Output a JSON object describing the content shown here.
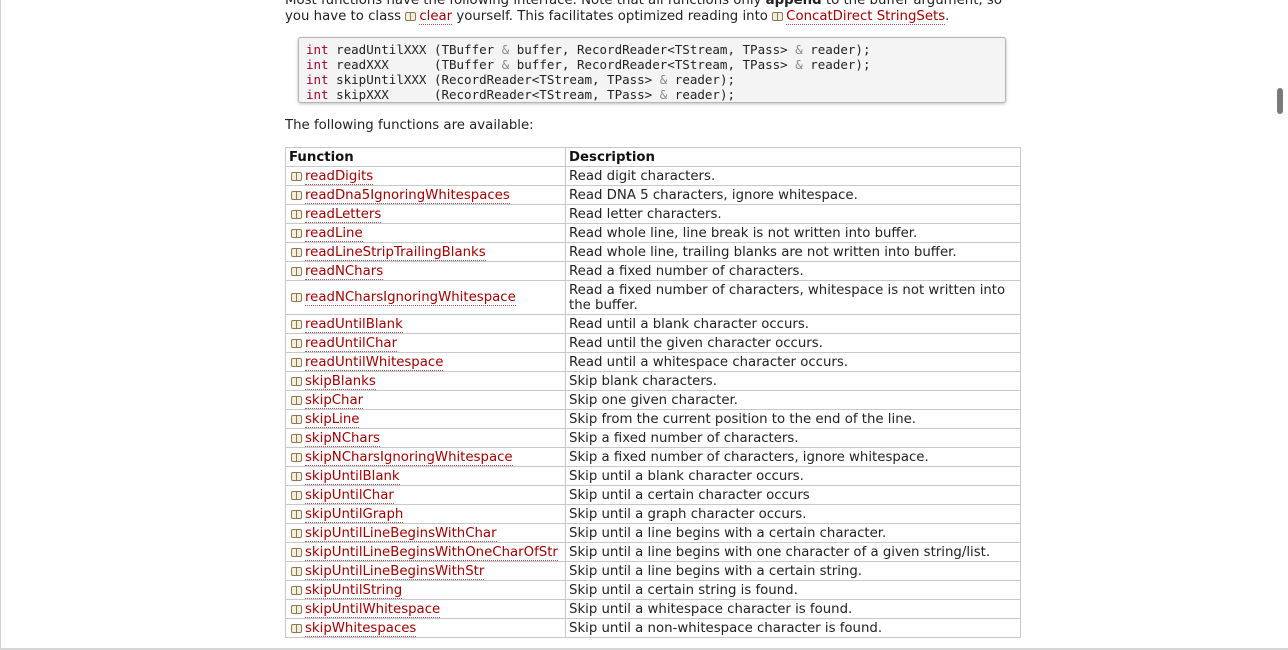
{
  "intro": {
    "line1_text": "Most functions have the following interface. Note that all functions only ",
    "line1_bold": "append",
    "line1_tail": " to the buffer argument, so",
    "line2_pre": "you have to class ",
    "clear_link": "clear",
    "line2_mid": " yourself. This facilitates optimized reading into ",
    "concat_link": "ConcatDirect StringSets",
    "line2_end": "."
  },
  "code_lines": [
    {
      "kw": "int",
      "name": "readUntilXXX",
      "pad": " ",
      "args_a": "(TBuffer ",
      "amp1": "&",
      "args_b": " buffer, RecordReader<TStream, TPass> ",
      "amp2": "&",
      "args_c": " reader);"
    },
    {
      "kw": "int",
      "name": "readXXX",
      "pad": "      ",
      "args_a": "(TBuffer ",
      "amp1": "&",
      "args_b": " buffer, RecordReader<TStream, TPass> ",
      "amp2": "&",
      "args_c": " reader);"
    },
    {
      "kw": "int",
      "name": "skipUntilXXX",
      "pad": " ",
      "args_a": "(RecordReader<TStream, TPass> ",
      "amp1": "&",
      "args_b": " reader);",
      "amp2": "",
      "args_c": ""
    },
    {
      "kw": "int",
      "name": "skipXXX",
      "pad": "      ",
      "args_a": "(RecordReader<TStream, TPass> ",
      "amp1": "&",
      "args_b": " reader);",
      "amp2": "",
      "args_c": ""
    }
  ],
  "available_text": "The following functions are available:",
  "table": {
    "headers": [
      "Function",
      "Description"
    ],
    "rows": [
      {
        "fn": "readDigits",
        "desc": "Read digit characters."
      },
      {
        "fn": "readDna5IgnoringWhitespaces",
        "desc": "Read DNA 5 characters, ignore whitespace."
      },
      {
        "fn": "readLetters",
        "desc": "Read letter characters."
      },
      {
        "fn": "readLine",
        "desc": "Read whole line, line break is not written into buffer."
      },
      {
        "fn": "readLineStripTrailingBlanks",
        "desc": "Read whole line, trailing blanks are not written into buffer."
      },
      {
        "fn": "readNChars",
        "desc": "Read a fixed number of characters."
      },
      {
        "fn": "readNCharsIgnoringWhitespace",
        "desc": "Read a fixed number of characters, whitespace is not written into the buffer."
      },
      {
        "fn": "readUntilBlank",
        "desc": "Read until a blank character occurs."
      },
      {
        "fn": "readUntilChar",
        "desc": "Read until the given character occurs."
      },
      {
        "fn": "readUntilWhitespace",
        "desc": "Read until a whitespace character occurs."
      },
      {
        "fn": "skipBlanks",
        "desc": "Skip blank characters."
      },
      {
        "fn": "skipChar",
        "desc": "Skip one given character."
      },
      {
        "fn": "skipLine",
        "desc": "Skip from the current position to the end of the line."
      },
      {
        "fn": "skipNChars",
        "desc": "Skip a fixed number of characters."
      },
      {
        "fn": "skipNCharsIgnoringWhitespace",
        "desc": "Skip a fixed number of characters, ignore whitespace."
      },
      {
        "fn": "skipUntilBlank",
        "desc": "Skip until a blank character occurs."
      },
      {
        "fn": "skipUntilChar",
        "desc": "Skip until a certain character occurs"
      },
      {
        "fn": "skipUntilGraph",
        "desc": "Skip until a graph character occurs."
      },
      {
        "fn": "skipUntilLineBeginsWithChar",
        "desc": "Skip until a line begins with a certain character."
      },
      {
        "fn": "skipUntilLineBeginsWithOneCharOfStr",
        "desc": "Skip until a line begins with one character of a given string/list."
      },
      {
        "fn": "skipUntilLineBeginsWithStr",
        "desc": "Skip until a line begins with a certain string."
      },
      {
        "fn": "skipUntilString",
        "desc": "Skip until a certain string is found."
      },
      {
        "fn": "skipUntilWhitespace",
        "desc": "Skip until a whitespace character is found."
      },
      {
        "fn": "skipWhitespaces",
        "desc": "Skip until a non-whitespace character is found."
      }
    ]
  },
  "icons": {
    "link_icon": "book-icon"
  },
  "colors": {
    "link": "#a00000",
    "keyword": "#a00030"
  }
}
